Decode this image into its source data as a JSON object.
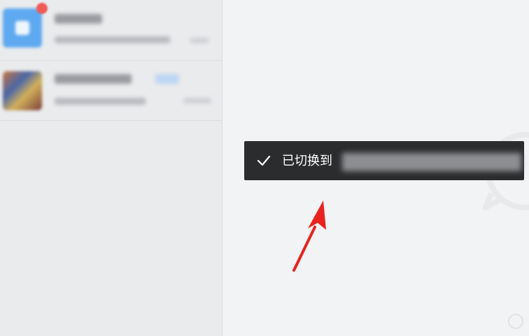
{
  "toast": {
    "message": "已切换到",
    "icon": "check-icon"
  },
  "sidebar": {
    "items": [
      {
        "avatar": "app-avatar-icon",
        "has_unread_badge": true
      },
      {
        "avatar": "photo-avatar",
        "has_tag": true
      }
    ]
  },
  "colors": {
    "toast_bg": "#2b2c2e",
    "sidebar_bg": "#eaebed",
    "main_bg": "#f2f3f5",
    "annotation_arrow": "#e8231f",
    "unread_badge": "#ee5b57"
  }
}
